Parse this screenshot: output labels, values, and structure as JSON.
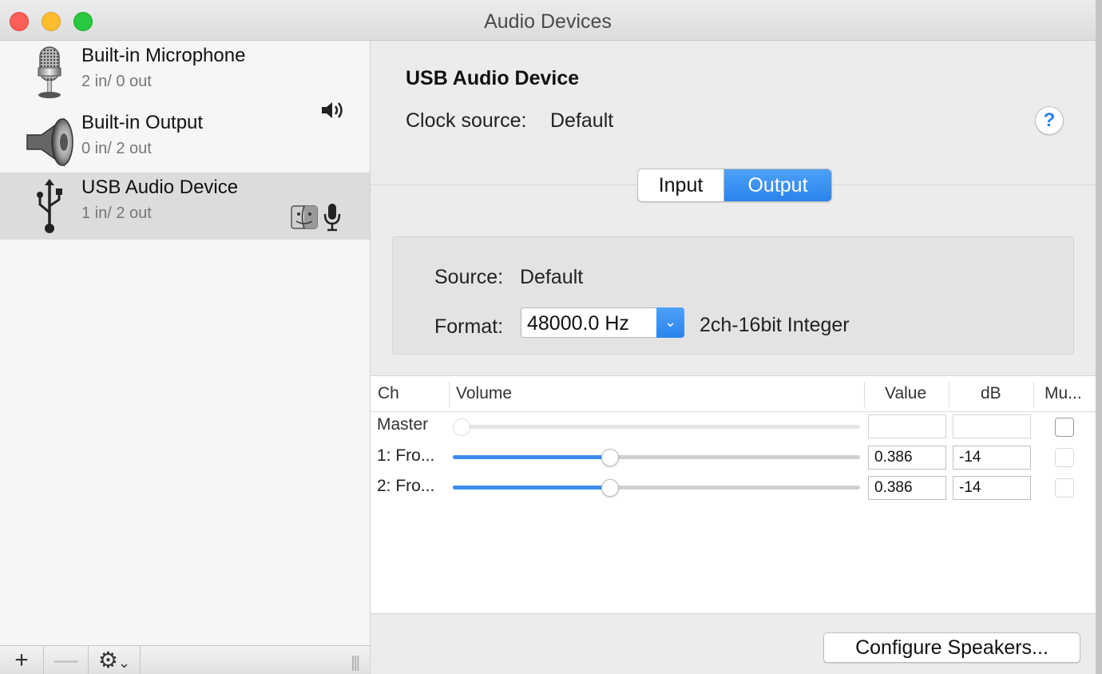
{
  "window": {
    "title": "Audio Devices"
  },
  "devices": [
    {
      "name": "Built-in Microphone",
      "io": "2 in/ 0 out",
      "icon": "microphone-icon"
    },
    {
      "name": "Built-in Output",
      "io": "0 in/ 2 out",
      "icon": "speaker-icon",
      "badges": [
        "speaker-volume-icon"
      ]
    },
    {
      "name": "USB Audio Device",
      "io": "1 in/ 2 out",
      "icon": "usb-icon",
      "selected": true,
      "badges": [
        "finder-icon",
        "microphone-small-icon"
      ]
    }
  ],
  "bottom_bar": {
    "add": "+",
    "remove": "—",
    "gear": "⚙",
    "gear_chevron": "⌄",
    "handle": "|||"
  },
  "detail": {
    "title": "USB Audio Device",
    "clock_source_label": "Clock source:",
    "clock_source_value": "Default",
    "help": "?",
    "tabs": [
      {
        "label": "Input",
        "active": false
      },
      {
        "label": "Output",
        "active": true
      }
    ],
    "source_label": "Source:",
    "source_value": "Default",
    "format_label": "Format:",
    "format_value": "48000.0 Hz",
    "format_arrow": "⌄",
    "format_desc": "2ch-16bit Integer"
  },
  "table": {
    "headers": {
      "ch": "Ch",
      "volume": "Volume",
      "value": "Value",
      "db": "dB",
      "mute": "Mu..."
    },
    "rows": [
      {
        "ch": "Master",
        "volume": 0,
        "value": "",
        "db": "",
        "mute": false,
        "enabled": false
      },
      {
        "ch": "1: Fro...",
        "volume": 0.386,
        "value": "0.386",
        "db": "-14",
        "mute": false,
        "enabled": true
      },
      {
        "ch": "2: Fro...",
        "volume": 0.386,
        "value": "0.386",
        "db": "-14",
        "mute": false,
        "enabled": true
      }
    ]
  },
  "configure_button": "Configure Speakers...",
  "colors": {
    "accent": "#2a84ee",
    "close": "#fc5f57",
    "minimize": "#fdbc2e",
    "maximize": "#28c840"
  }
}
